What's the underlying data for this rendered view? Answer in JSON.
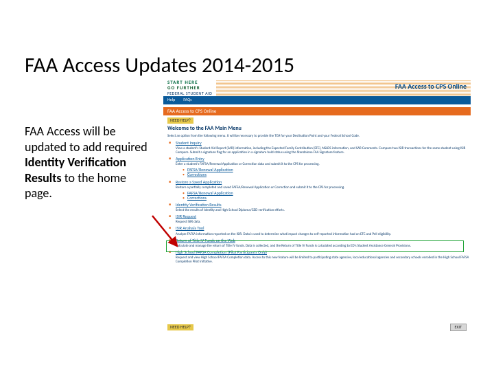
{
  "slide": {
    "title": "FAA Access Updates 2014-2015",
    "body_pre": "FAA Access will be updated to add required ",
    "body_bold": "Identity Verification Results",
    "body_post": " to the home page."
  },
  "banner": {
    "logo_top": "START HERE",
    "logo_mid": "GO FURTHER",
    "logo_bottom": "FEDERAL STUDENT AID",
    "app_title": "FAA Access to CPS Online"
  },
  "tabs": {
    "t1": "Help",
    "t2": "FAQs"
  },
  "orangebar": {
    "crumb": "FAA Access to CPS Online"
  },
  "help": {
    "label": "NEED HELP?"
  },
  "welcome": {
    "heading": "Welcome to the FAA Main Menu",
    "intro": "Select an option from the following menu. It will be necessary to provide the TG# for your Destination Point and your Federal School Code."
  },
  "items": [
    {
      "title": "Student Inquiry",
      "desc": "View a student's Student Aid Report (SAR) information, including the Expected Family Contribution (EFC), NSLDS information, and SAR Comments. Compare two ISIR transactions for the same student using ISIR Compare. Submit a signature flag for an application in a signature hold status using the Standalone FAA Signature feature."
    },
    {
      "title": "Application Entry",
      "desc": "Enter a student's FAFSA/Renewal Application or Correction data and submit it to the CPS for processing.",
      "sub": [
        "FAFSA/Renewal Application",
        "Corrections"
      ]
    },
    {
      "title": "Restore a Saved Application",
      "desc": "Restore a partially completed and saved FAFSA/Renewal Application or Correction and submit it to the CPS for processing.",
      "sub": [
        "FAFSA/Renewal Application",
        "Corrections"
      ]
    },
    {
      "title": "Identity Verification Results",
      "desc": "Select the results of Identity and High School Diploma/GED verification efforts."
    },
    {
      "title": "ISIR Request",
      "desc": "Request ISIR data."
    },
    {
      "title": "ISIR Analysis Tool",
      "desc": "Analyze FAFSA information reported on the ISIR. Data is used to determine what impact changes to self-reported information had on EFC and Pell eligibility."
    },
    {
      "title": "Return of Title IV Funds on the Web",
      "desc": "Calculate and manage the return of Title IV funds. Data is collected, and the Return of Title IV Funds is calculated according to ED's Student Assistance General Provisions."
    },
    {
      "title": "High School FAFSA Completion (Pilot Participants Only)",
      "desc": "Request and view High School FAFSA Completion data. Access to this new feature will be limited to participating state agencies, local educational agencies and secondary schools enrolled in the High School FAFSA Completion Pilot Initiative."
    }
  ],
  "bottom": {
    "help": "NEED HELP?",
    "exit": "EXIT"
  }
}
